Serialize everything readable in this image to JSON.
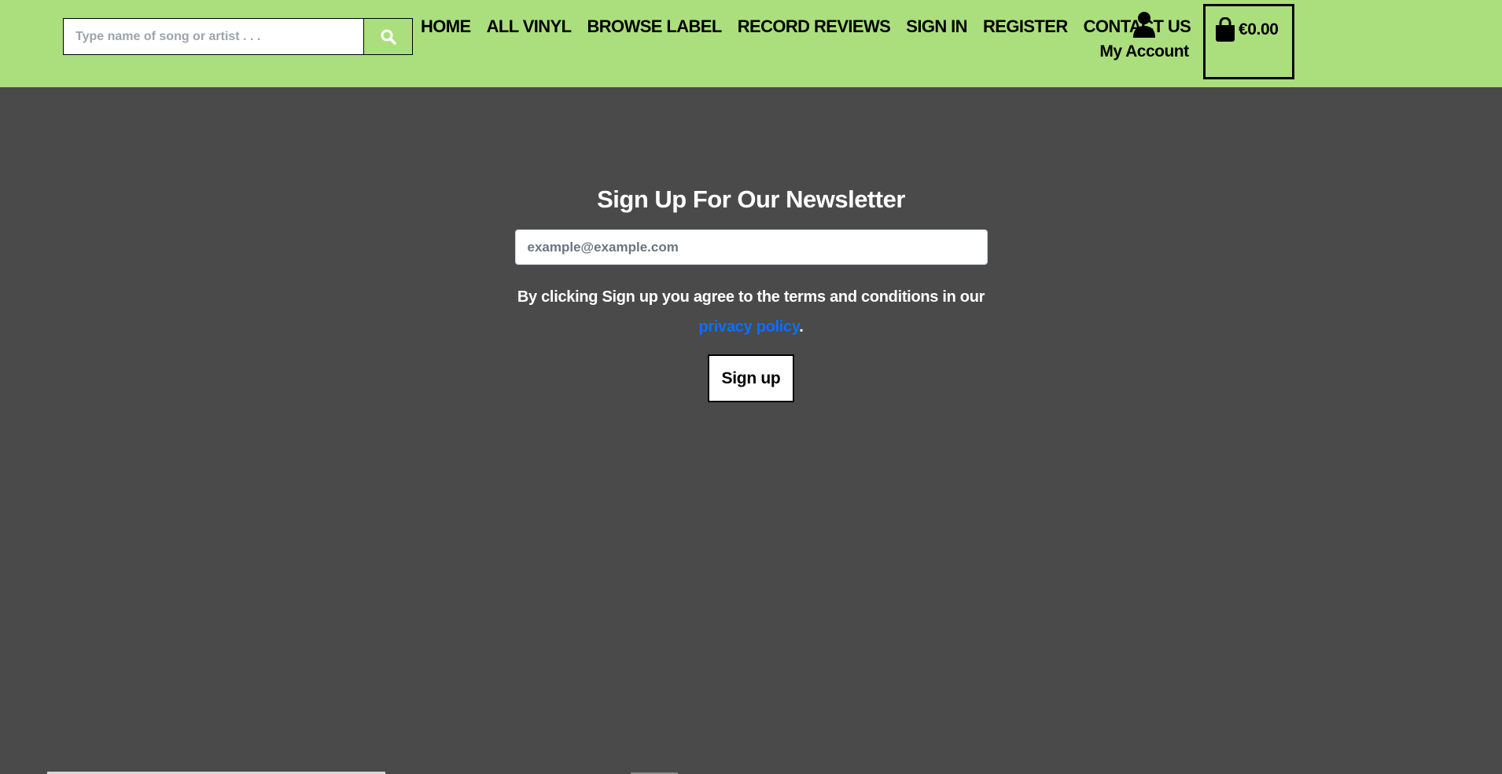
{
  "search": {
    "placeholder": "Type name of song or artist . . .",
    "icon": "search-icon"
  },
  "nav": {
    "items": [
      {
        "label": "HOME"
      },
      {
        "label": "ALL VINYL"
      },
      {
        "label": "BROWSE LABEL"
      },
      {
        "label": "RECORD REVIEWS"
      },
      {
        "label": "SIGN IN"
      },
      {
        "label": "REGISTER"
      },
      {
        "label": "CONTACT US"
      }
    ]
  },
  "account": {
    "label": "My Account",
    "icon": "user-icon"
  },
  "cart": {
    "total": "€0.00",
    "icon": "shopping-bag-icon"
  },
  "newsletter": {
    "title": "Sign Up For Our Newsletter",
    "email_placeholder": "example@example.com",
    "terms_text": "By clicking Sign up you agree to the terms and conditions in our",
    "privacy_link": "privacy policy",
    "terms_suffix": ".",
    "button_label": "Sign up"
  },
  "colors": {
    "header_bg": "#abdf7e",
    "page_bg": "#4a4a4a",
    "link": "#0d6efd"
  }
}
